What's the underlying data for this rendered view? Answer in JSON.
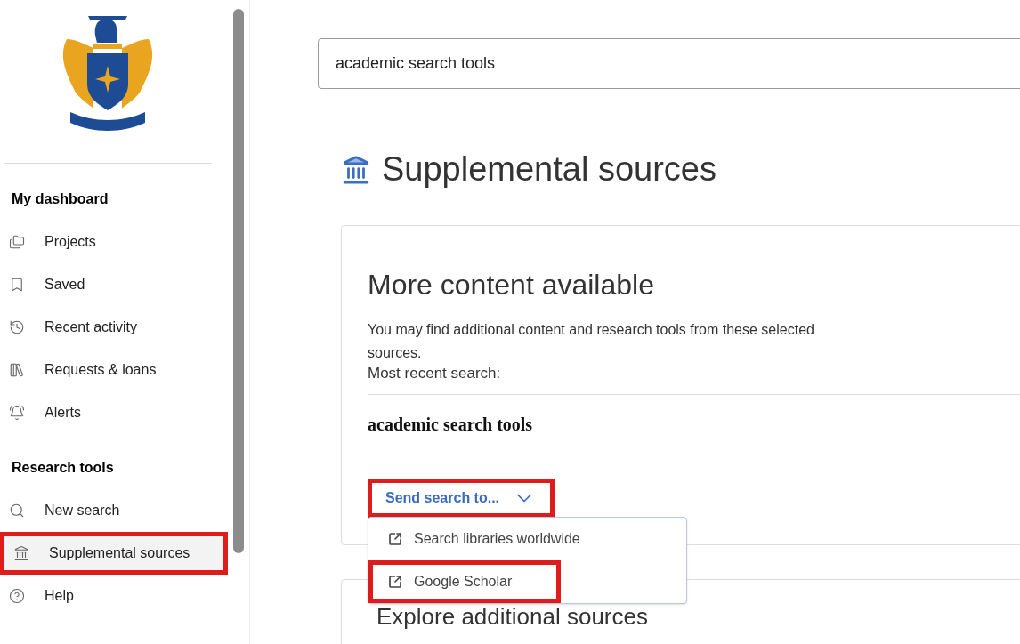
{
  "search": {
    "value": "academic search tools"
  },
  "sidebar": {
    "sections": [
      {
        "heading": "My dashboard",
        "items": [
          {
            "kind": "folder",
            "label": "Projects",
            "selected": false,
            "highlighted": false
          },
          {
            "kind": "bookmark",
            "label": "Saved",
            "selected": false,
            "highlighted": false
          },
          {
            "kind": "history",
            "label": "Recent activity",
            "selected": false,
            "highlighted": false
          },
          {
            "kind": "books",
            "label": "Requests & loans",
            "selected": false,
            "highlighted": false
          },
          {
            "kind": "bell",
            "label": "Alerts",
            "selected": false,
            "highlighted": false
          }
        ]
      },
      {
        "heading": "Research tools",
        "items": [
          {
            "kind": "search",
            "label": "New search",
            "selected": false,
            "highlighted": false
          },
          {
            "kind": "bank",
            "label": "Supplemental sources",
            "selected": true,
            "highlighted": true
          },
          {
            "kind": "help",
            "label": "Help",
            "selected": false,
            "highlighted": false
          }
        ]
      }
    ]
  },
  "page": {
    "title": "Supplemental sources",
    "card": {
      "heading": "More content available",
      "description": "You may find additional content and research tools from these selected sources.",
      "recent_label": "Most recent search:",
      "recent_query": "academic search tools",
      "dropdown": {
        "label": "Send search to...",
        "expanded": true,
        "highlighted": true,
        "options": [
          {
            "label": "Search libraries worldwide",
            "highlighted": false
          },
          {
            "label": "Google Scholar",
            "highlighted": true
          }
        ]
      }
    },
    "next_card": {
      "heading": "Explore additional sources"
    }
  }
}
